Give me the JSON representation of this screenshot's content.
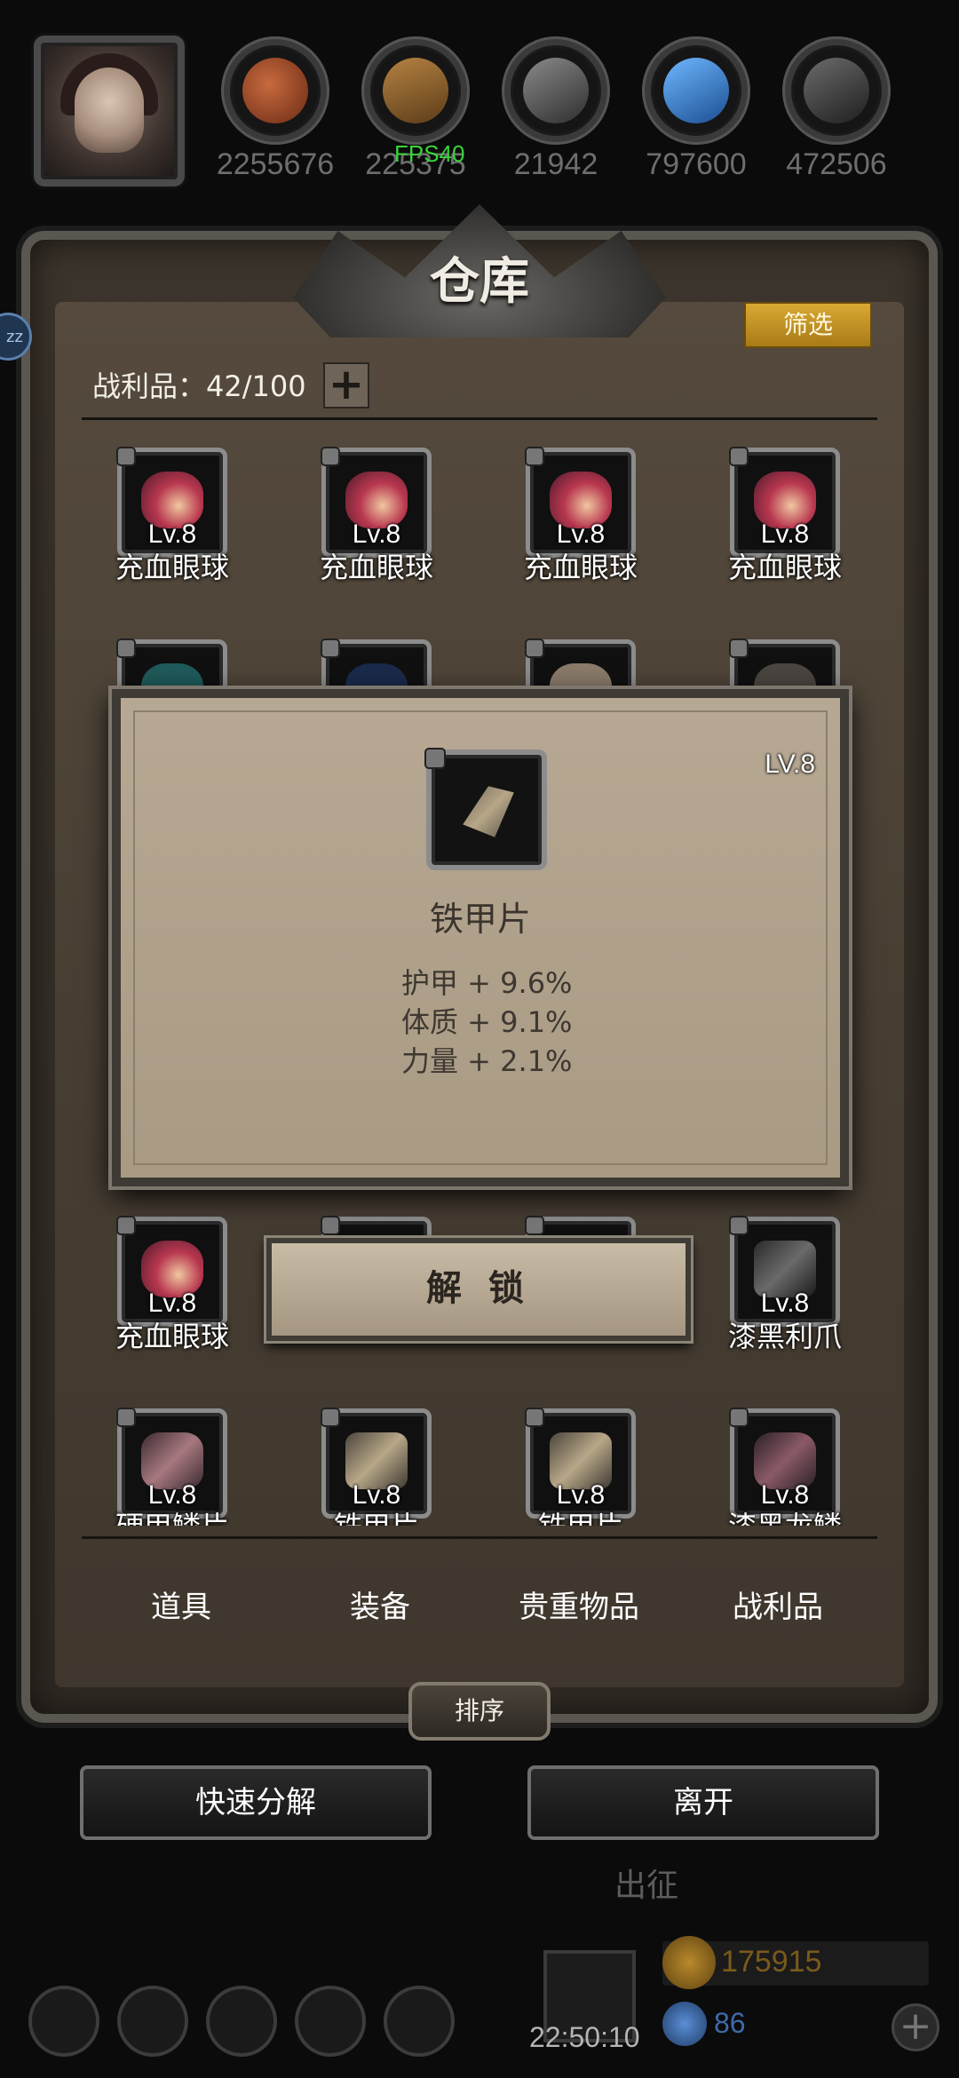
{
  "resources": [
    {
      "icon": "meat-icon",
      "value": "2255676",
      "color": "#8a3a1e"
    },
    {
      "icon": "wood-icon",
      "value": "225375",
      "color": "#7a5426"
    },
    {
      "icon": "stone-icon",
      "value": "21942",
      "color": "#5c5c5c"
    },
    {
      "icon": "crystal-icon",
      "value": "797600",
      "color": "#2c7ac8"
    },
    {
      "icon": "iron-icon",
      "value": "472506",
      "color": "#4a4a4a"
    }
  ],
  "fps": "FPS40",
  "warehouse": {
    "title": "仓库",
    "filter_label": "筛选",
    "loot_label": "战利品：42/100",
    "plus_label": "+"
  },
  "grid": {
    "row1": [
      {
        "level": "Lv.8",
        "name": "充血眼球"
      },
      {
        "level": "Lv.8",
        "name": "充血眼球"
      },
      {
        "level": "Lv.8",
        "name": "充血眼球"
      },
      {
        "level": "Lv.8",
        "name": "充血眼球"
      }
    ],
    "row4": [
      {
        "level": "Lv.8",
        "name": "充血眼球"
      },
      {
        "level": "Lv.8",
        "name": "漆黑利爪"
      }
    ],
    "row5": [
      {
        "level": "Lv.8",
        "name": "硬甲鳞片"
      },
      {
        "level": "Lv.8",
        "name": "铁甲片"
      },
      {
        "level": "Lv.8",
        "name": "铁甲片"
      },
      {
        "level": "Lv.8",
        "name": "漆黑龙鳞"
      }
    ]
  },
  "tooltip": {
    "level": "LV.8",
    "name": "铁甲片",
    "stats": [
      "护甲 + 9.6%",
      "体质 + 9.1%",
      "力量 + 2.1%"
    ]
  },
  "unlock_label": "解 锁",
  "tabs": [
    "道具",
    "装备",
    "贵重物品",
    "战利品"
  ],
  "sort_label": "排序",
  "quick_decompose_label": "快速分解",
  "leave_label": "离开",
  "backdrop": {
    "expedition_label": "出征",
    "clock": "22:50:10",
    "gold": "175915",
    "gems": "86"
  }
}
